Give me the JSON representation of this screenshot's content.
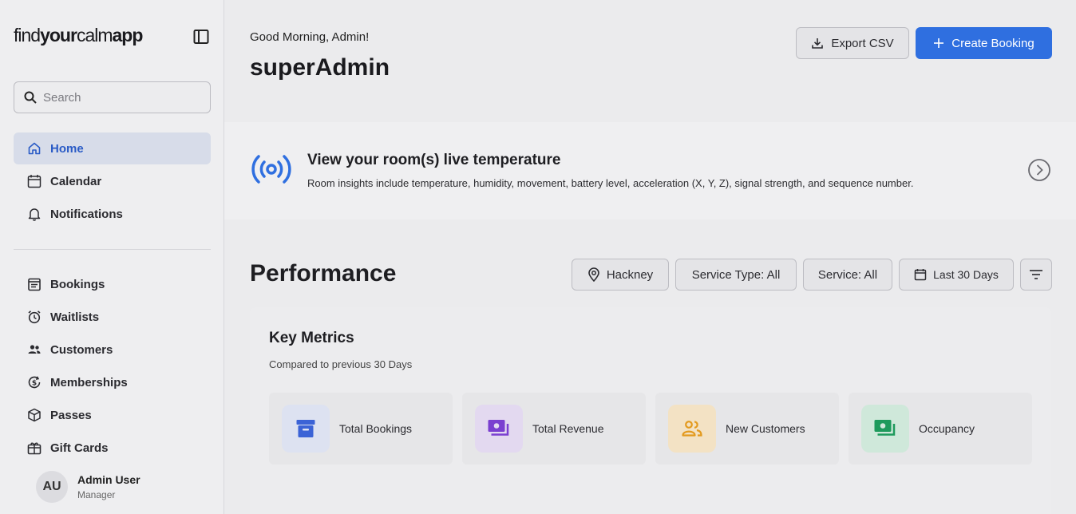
{
  "sidebar": {
    "logo": {
      "part1": "find",
      "part2": "your",
      "part3": "calm",
      "part4": "app"
    },
    "search": {
      "placeholder": "Search"
    },
    "nav_primary": [
      {
        "label": "Home",
        "icon": "home-icon",
        "active": true
      },
      {
        "label": "Calendar",
        "icon": "calendar-icon"
      },
      {
        "label": "Notifications",
        "icon": "bell-icon"
      }
    ],
    "nav_secondary": [
      {
        "label": "Bookings",
        "icon": "bookings-icon"
      },
      {
        "label": "Waitlists",
        "icon": "alarm-icon"
      },
      {
        "label": "Customers",
        "icon": "customers-icon"
      },
      {
        "label": "Memberships",
        "icon": "membership-icon"
      },
      {
        "label": "Passes",
        "icon": "package-icon"
      },
      {
        "label": "Gift Cards",
        "icon": "gift-icon"
      }
    ],
    "user": {
      "initials": "AU",
      "name": "Admin User",
      "role": "Manager"
    }
  },
  "header": {
    "greeting": "Good Morning, Admin!",
    "title": "superAdmin",
    "export_label": "Export CSV",
    "create_label": "Create Booking"
  },
  "banner": {
    "title": "View your room(s) live temperature",
    "description": "Room insights include temperature, humidity, movement, battery level, acceleration (X, Y, Z), signal strength, and sequence number."
  },
  "performance": {
    "title": "Performance",
    "filters": {
      "location": "Hackney",
      "service_type": "Service Type: All",
      "service": "Service: All",
      "date_range": "Last 30 Days"
    }
  },
  "key_metrics": {
    "title": "Key Metrics",
    "subtitle": "Compared to previous 30 Days",
    "items": [
      {
        "label": "Total Bookings",
        "icon": "archive-icon",
        "color": "#3b63d6",
        "bg": "#dde2f1"
      },
      {
        "label": "Total Revenue",
        "icon": "money-icon",
        "color": "#7a3fd0",
        "bg": "#e3d9f0"
      },
      {
        "label": "New Customers",
        "icon": "users-icon",
        "color": "#e39a1e",
        "bg": "#f3e2c4"
      },
      {
        "label": "Occupancy",
        "icon": "cash-icon",
        "color": "#1e9a5c",
        "bg": "#cfe8da"
      }
    ]
  },
  "colors": {
    "accent": "#2f6fe0",
    "active_nav_bg": "#d7dce9",
    "active_nav_text": "#2a5bc6"
  }
}
